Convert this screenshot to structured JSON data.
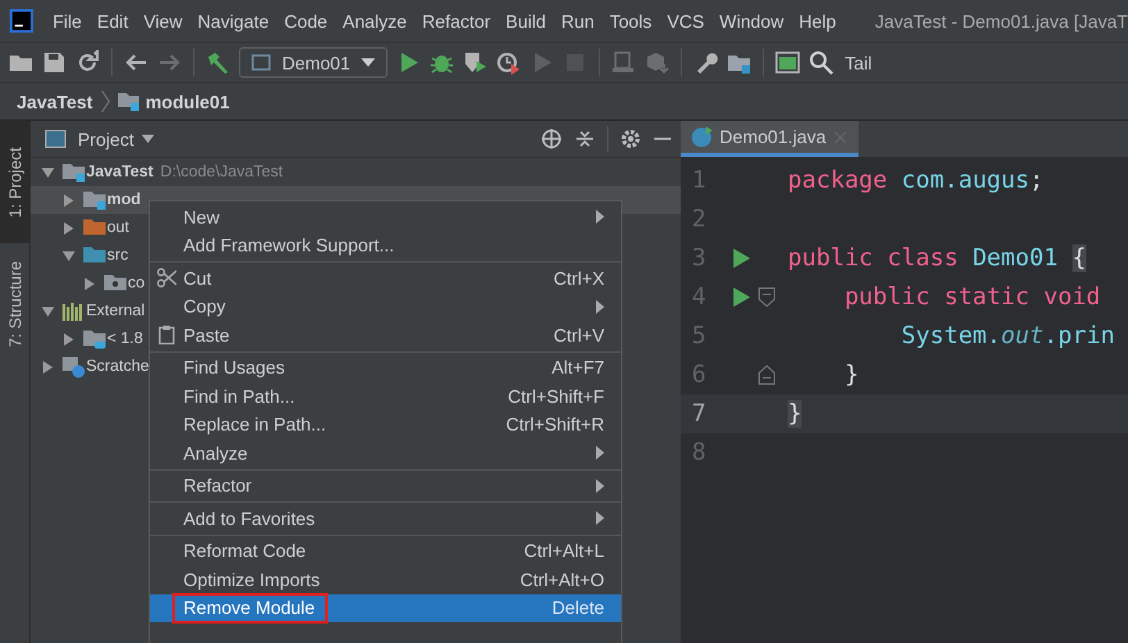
{
  "window": {
    "title": "JavaTest - Demo01.java [JavaT"
  },
  "menubar": [
    "File",
    "Edit",
    "View",
    "Navigate",
    "Code",
    "Analyze",
    "Refactor",
    "Build",
    "Run",
    "Tools",
    "VCS",
    "Window",
    "Help"
  ],
  "toolbar": [
    [
      {
        "kind": "open",
        "disabled": false
      },
      {
        "kind": "save",
        "disabled": false
      },
      {
        "kind": "sync",
        "disabled": false
      }
    ],
    [
      {
        "kind": "back",
        "disabled": false
      },
      {
        "kind": "forward",
        "disabled": true
      }
    ],
    [
      {
        "kind": "build",
        "disabled": false
      },
      {
        "kind": "config",
        "label": "Demo01",
        "disabled": false
      },
      {
        "kind": "run",
        "disabled": false
      },
      {
        "kind": "debug",
        "disabled": false
      },
      {
        "kind": "coverage",
        "disabled": false
      },
      {
        "kind": "profile",
        "disabled": false
      },
      {
        "kind": "run",
        "disabled": true
      },
      {
        "kind": "stop",
        "disabled": true
      }
    ],
    [
      {
        "kind": "device",
        "disabled": true
      },
      {
        "kind": "deploy",
        "disabled": true
      }
    ],
    [
      {
        "kind": "wrench",
        "disabled": false
      },
      {
        "kind": "folder",
        "disabled": false
      }
    ],
    [
      {
        "kind": "terminal",
        "disabled": false
      },
      {
        "kind": "search",
        "disabled": false
      },
      {
        "kind": "label",
        "label": "Tail",
        "disabled": false
      }
    ]
  ],
  "breadcrumb": [
    {
      "label": "JavaTest",
      "kind": "text"
    },
    {
      "label": "module01",
      "kind": "module"
    }
  ],
  "side_tabs": [
    {
      "label": "1: Project",
      "selected": true
    },
    {
      "label": "7: Structure",
      "selected": false
    }
  ],
  "project": {
    "title": "Project",
    "tree": [
      {
        "label": "JavaTest",
        "path": "D:\\code\\JavaTest",
        "kind": "module",
        "bold": true,
        "expanded": true,
        "selected": false,
        "children": [
          {
            "label": "mod",
            "kind": "module",
            "bold": true,
            "expanded": false,
            "selected": true
          },
          {
            "label": "out",
            "kind": "excluded",
            "bold": false,
            "expanded": false,
            "selected": false
          },
          {
            "label": "src",
            "kind": "source",
            "bold": false,
            "expanded": true,
            "selected": false,
            "children": [
              {
                "label": "co",
                "kind": "package",
                "bold": false,
                "expanded": false,
                "selected": false
              }
            ]
          }
        ]
      },
      {
        "label": "External",
        "kind": "library",
        "bold": false,
        "expanded": true,
        "selected": false,
        "children": [
          {
            "label": "< 1.8",
            "kind": "sdk",
            "bold": false,
            "expanded": false,
            "selected": false
          }
        ]
      },
      {
        "label": "Scratche",
        "kind": "scratch",
        "bold": false,
        "expanded": false,
        "selected": false
      }
    ]
  },
  "context_menu": [
    {
      "label": "New",
      "kind": "item",
      "submenu": true,
      "separator_before": false,
      "selected": false
    },
    {
      "label": "Add Framework Support...",
      "kind": "item",
      "submenu": false,
      "separator_before": false,
      "selected": false
    },
    {
      "label": "Cut",
      "kind": "cut",
      "shortcut": "Ctrl+X",
      "submenu": false,
      "separator_before": true,
      "selected": false
    },
    {
      "label": "Copy",
      "kind": "item",
      "submenu": true,
      "separator_before": false,
      "selected": false
    },
    {
      "label": "Paste",
      "kind": "paste",
      "shortcut": "Ctrl+V",
      "submenu": false,
      "separator_before": false,
      "selected": false
    },
    {
      "label": "Find Usages",
      "kind": "item",
      "shortcut": "Alt+F7",
      "submenu": false,
      "separator_before": true,
      "selected": false
    },
    {
      "label": "Find in Path...",
      "kind": "item",
      "shortcut": "Ctrl+Shift+F",
      "submenu": false,
      "separator_before": false,
      "selected": false
    },
    {
      "label": "Replace in Path...",
      "kind": "item",
      "shortcut": "Ctrl+Shift+R",
      "submenu": false,
      "separator_before": false,
      "selected": false
    },
    {
      "label": "Analyze",
      "kind": "item",
      "submenu": true,
      "separator_before": false,
      "selected": false
    },
    {
      "label": "Refactor",
      "kind": "item",
      "submenu": true,
      "separator_before": true,
      "selected": false
    },
    {
      "label": "Add to Favorites",
      "kind": "item",
      "submenu": true,
      "separator_before": true,
      "selected": false
    },
    {
      "label": "Reformat Code",
      "kind": "item",
      "shortcut": "Ctrl+Alt+L",
      "submenu": false,
      "separator_before": true,
      "selected": false
    },
    {
      "label": "Optimize Imports",
      "kind": "item",
      "shortcut": "Ctrl+Alt+O",
      "submenu": false,
      "separator_before": false,
      "selected": false
    },
    {
      "label": "Remove Module",
      "kind": "item",
      "shortcut": "Delete",
      "submenu": false,
      "separator_before": false,
      "selected": true,
      "annotated": true
    }
  ],
  "editor": {
    "tab": {
      "label": "Demo01.java",
      "selected": true
    },
    "lines": [
      {
        "number": "1",
        "run": false,
        "fold_start": false,
        "fold_end": false,
        "current": false,
        "tokens": [
          {
            "text": "package",
            "kind": "keyword"
          },
          {
            "text": " com.augus",
            "kind": "ident"
          },
          {
            "text": ";",
            "kind": "plain"
          }
        ]
      },
      {
        "number": "2",
        "run": false,
        "fold_start": false,
        "fold_end": false,
        "current": false
      },
      {
        "number": "3",
        "run": true,
        "fold_start": false,
        "fold_end": false,
        "current": false,
        "tokens": [
          {
            "text": "public class",
            "kind": "keyword"
          },
          {
            "text": " Demo01 ",
            "kind": "ident"
          },
          {
            "text": "{",
            "kind": "brace"
          }
        ]
      },
      {
        "number": "4",
        "run": true,
        "fold_start": true,
        "fold_end": false,
        "current": false,
        "tokens": [
          {
            "text": "    public static void",
            "kind": "keyword"
          }
        ]
      },
      {
        "number": "5",
        "run": false,
        "fold_start": false,
        "fold_end": false,
        "current": false,
        "tokens": [
          {
            "text": "        System.",
            "kind": "ident"
          },
          {
            "text": "out",
            "kind": "italic"
          },
          {
            "text": ".prin",
            "kind": "ident"
          }
        ]
      },
      {
        "number": "6",
        "run": false,
        "fold_start": false,
        "fold_end": true,
        "current": false,
        "tokens": [
          {
            "text": "    }",
            "kind": "plain"
          }
        ]
      },
      {
        "number": "7",
        "run": false,
        "fold_start": false,
        "fold_end": false,
        "current": true,
        "tokens": [
          {
            "text": "}",
            "kind": "brace"
          }
        ]
      },
      {
        "number": "8",
        "run": false,
        "fold_start": false,
        "fold_end": false,
        "current": false
      }
    ]
  }
}
